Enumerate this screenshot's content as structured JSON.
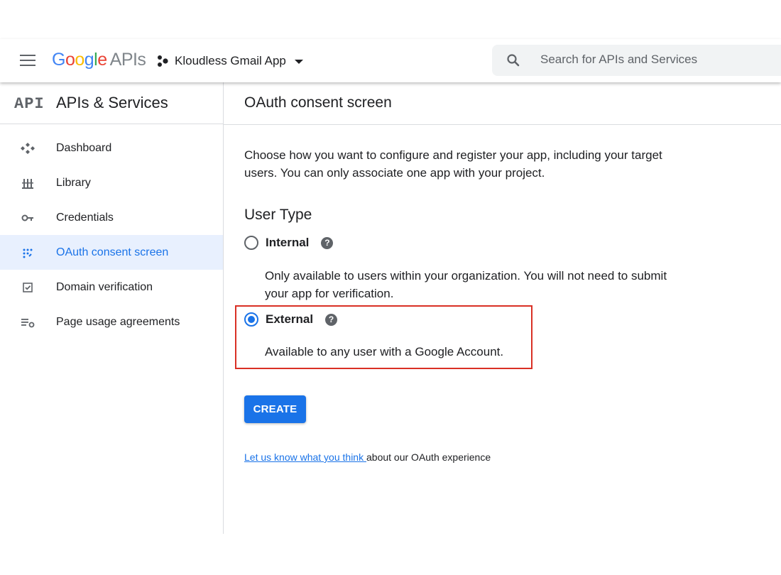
{
  "header": {
    "logo_letters": [
      "G",
      "o",
      "o",
      "g",
      "l",
      "e"
    ],
    "logo_suffix": "APIs",
    "project_name": "Kloudless Gmail App",
    "search_placeholder": "Search for APIs and Services"
  },
  "sidebar": {
    "logo_text": "API",
    "title": "APIs & Services",
    "items": [
      {
        "label": "Dashboard",
        "icon": "dashboard-icon"
      },
      {
        "label": "Library",
        "icon": "library-icon"
      },
      {
        "label": "Credentials",
        "icon": "key-icon"
      },
      {
        "label": "OAuth consent screen",
        "icon": "consent-icon",
        "active": true
      },
      {
        "label": "Domain verification",
        "icon": "checkbox-icon"
      },
      {
        "label": "Page usage agreements",
        "icon": "settings-list-icon"
      }
    ]
  },
  "main": {
    "title": "OAuth consent screen",
    "intro": "Choose how you want to configure and register your app, including your target users. You can only associate one app with your project.",
    "user_type_title": "User Type",
    "options": [
      {
        "label": "Internal",
        "description": "Only available to users within your organization. You will not need to submit your app for verification.",
        "selected": false
      },
      {
        "label": "External",
        "description": "Available to any user with a Google Account.",
        "selected": true
      }
    ],
    "help_glyph": "?",
    "create_label": "CREATE",
    "feedback_link": "Let us know what you think ",
    "feedback_text": "about our OAuth experience"
  },
  "colors": {
    "accent": "#1a73e8",
    "active_bg": "#e8f0fe",
    "highlight_border": "#d93025"
  }
}
